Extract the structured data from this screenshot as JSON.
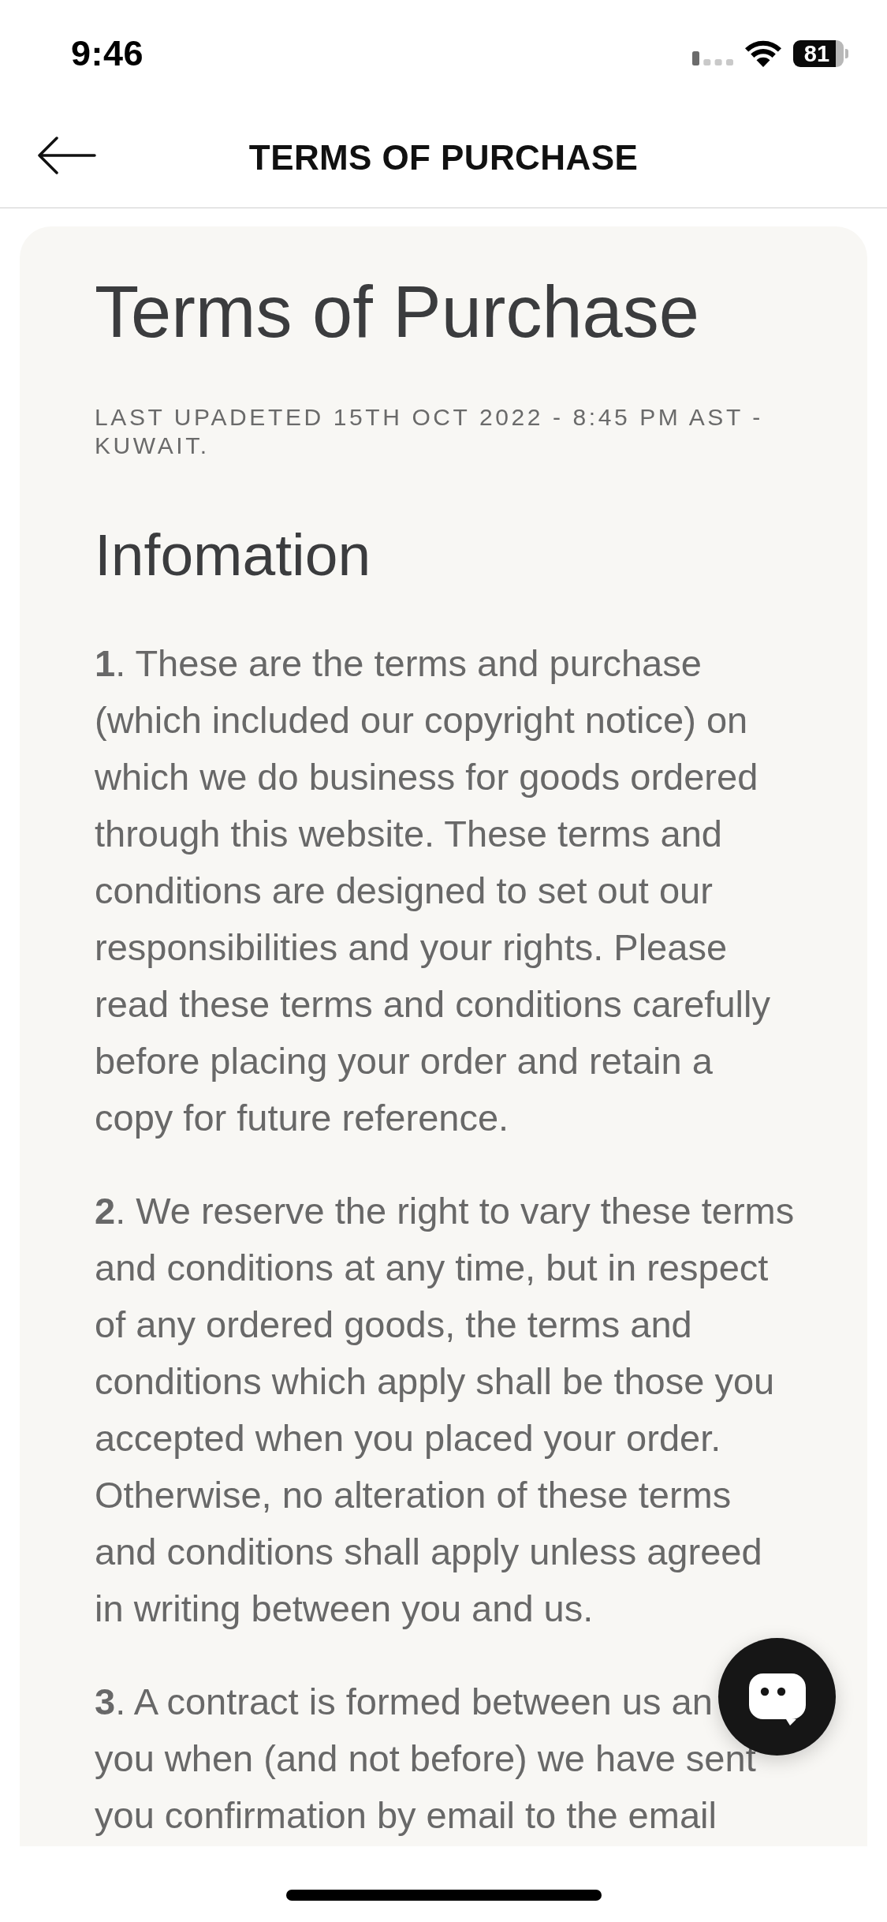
{
  "status_bar": {
    "time": "9:46",
    "battery": "81"
  },
  "header": {
    "title": "TERMS OF PURCHASE"
  },
  "content": {
    "title": "Terms of Purchase",
    "last_updated": "LAST UPADETED 15TH OCT 2022 - 8:45 PM AST - KUWAIT.",
    "heading": "Infomation",
    "paragraphs": [
      {
        "lines": [
          "**1**. These are the terms and purchase",
          "(which included our copyright notice) on",
          "which we do business for goods ordered",
          "through this website. These terms and",
          "conditions are designed to set out our",
          "responsibilities and your rights. Please",
          "read these terms and conditions carefully",
          "before placing your order and retain a",
          "copy for future reference."
        ]
      },
      {
        "lines": [
          "**2**. We reserve the right to vary these terms",
          "and conditions at any time, but in respect",
          "of any ordered goods, the terms and",
          "conditions which apply shall be those you",
          "accepted when you placed your order.",
          "Otherwise, no alteration of these terms",
          "and conditions shall apply unless agreed",
          "in writing between you and us."
        ]
      },
      {
        "lines": [
          "**3**. A contract is formed between us an",
          "you when (and not before) we have sent",
          "you confirmation by email to the email"
        ]
      }
    ]
  }
}
